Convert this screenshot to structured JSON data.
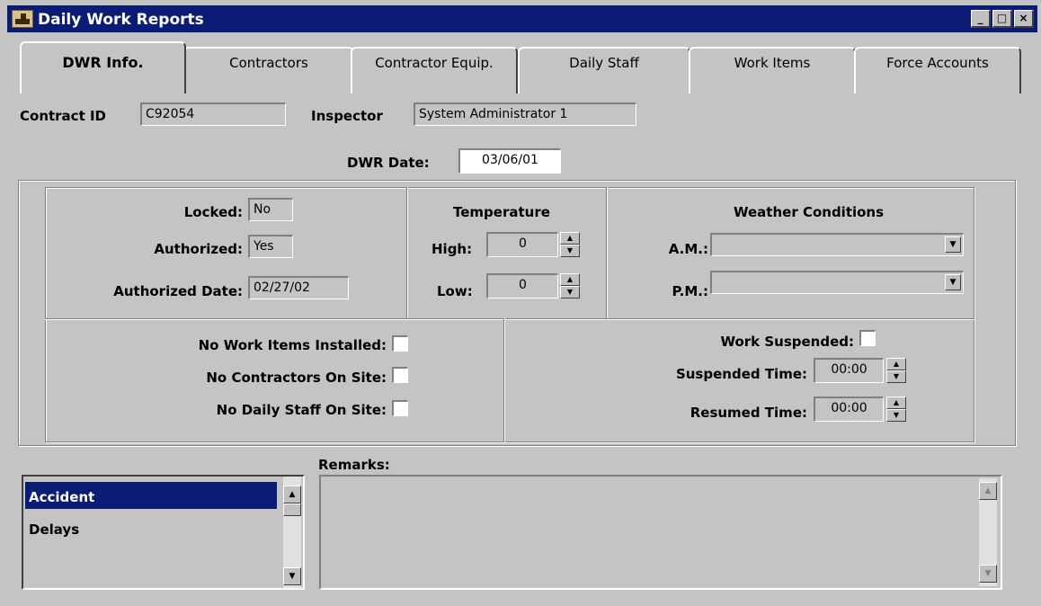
{
  "window": {
    "title": "Daily Work Reports",
    "minimize": "_",
    "maximize": "□",
    "close": "×"
  },
  "tabs": [
    "DWR Info.",
    "Contractors",
    "Contractor Equip.",
    "Daily Staff",
    "Work Items",
    "Force Accounts"
  ],
  "header": {
    "contract_id_label": "Contract ID",
    "contract_id_value": "C92054",
    "inspector_label": "Inspector",
    "inspector_value": "System Administrator 1",
    "dwr_date_label": "DWR Date:",
    "dwr_date_value": "03/06/01"
  },
  "status": {
    "locked_label": "Locked:",
    "locked_value": "No",
    "authorized_label": "Authorized:",
    "authorized_value": "Yes",
    "authorized_date_label": "Authorized Date:",
    "authorized_date_value": "02/27/02"
  },
  "temperature": {
    "heading": "Temperature",
    "high_label": "High:",
    "high_value": "0",
    "low_label": "Low:",
    "low_value": "0"
  },
  "weather": {
    "heading": "Weather Conditions",
    "am_label": "A.M.:",
    "am_value": "",
    "pm_label": "P.M.:",
    "pm_value": ""
  },
  "flags": {
    "no_work_items_label": "No Work Items Installed:",
    "no_work_items_checked": false,
    "no_contractors_label": "No Contractors On Site:",
    "no_contractors_checked": false,
    "no_daily_staff_label": "No Daily Staff On Site:",
    "no_daily_staff_checked": false
  },
  "suspension": {
    "work_suspended_label": "Work Suspended:",
    "work_suspended_checked": false,
    "suspended_time_label": "Suspended Time:",
    "suspended_time_value": "00:00",
    "resumed_time_label": "Resumed Time:",
    "resumed_time_value": "00:00"
  },
  "remarks": {
    "label": "Remarks:",
    "categories": [
      "Accident",
      "Delays"
    ],
    "selected": "Accident",
    "text": ""
  },
  "colors": {
    "titlebar": "#0a1c74",
    "selection": "#0a1c74",
    "face": "#c4c4c4"
  }
}
